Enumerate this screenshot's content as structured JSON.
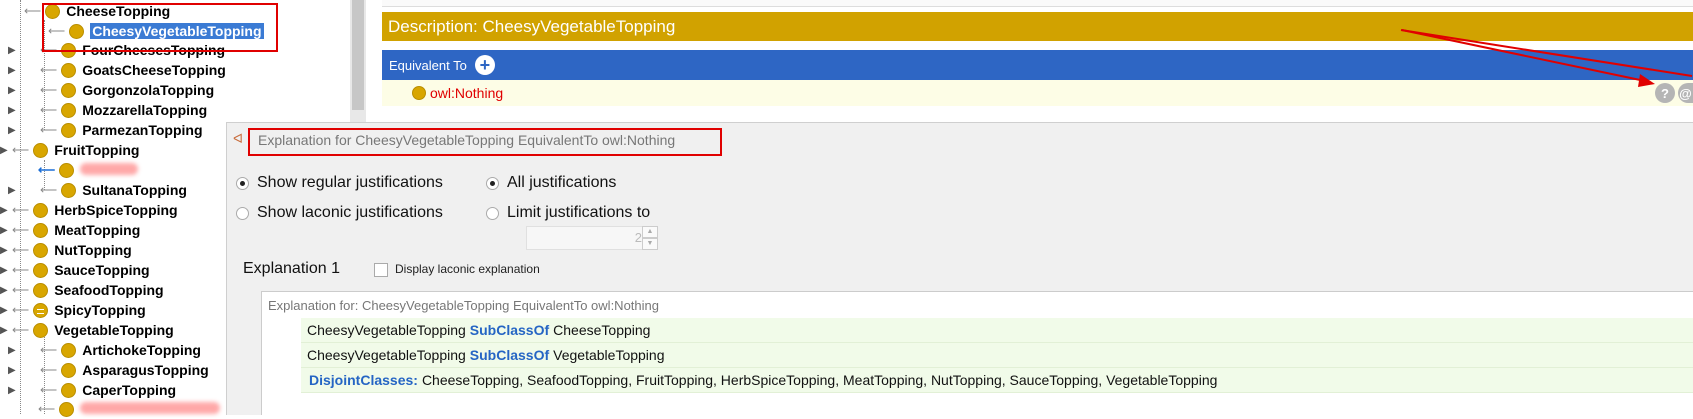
{
  "tree": {
    "nodes": [
      {
        "label": "CheeseTopping",
        "selected": false,
        "blurred": false
      },
      {
        "label": "CheesyVegetableTopping",
        "selected": true,
        "blurred": false
      },
      {
        "label": "FourCheesesTopping",
        "selected": false,
        "blurred": false
      },
      {
        "label": "GoatsCheeseTopping",
        "selected": false,
        "blurred": false
      },
      {
        "label": "GorgonzolaTopping",
        "selected": false,
        "blurred": false
      },
      {
        "label": "MozzarellaTopping",
        "selected": false,
        "blurred": false
      },
      {
        "label": "ParmezanTopping",
        "selected": false,
        "blurred": false
      },
      {
        "label": "FruitTopping",
        "selected": false,
        "blurred": false
      },
      {
        "label": "",
        "selected": false,
        "blurred": true
      },
      {
        "label": "SultanaTopping",
        "selected": false,
        "blurred": false
      },
      {
        "label": "HerbSpiceTopping",
        "selected": false,
        "blurred": false
      },
      {
        "label": "MeatTopping",
        "selected": false,
        "blurred": false
      },
      {
        "label": "NutTopping",
        "selected": false,
        "blurred": false
      },
      {
        "label": "SauceTopping",
        "selected": false,
        "blurred": false
      },
      {
        "label": "SeafoodTopping",
        "selected": false,
        "blurred": false
      },
      {
        "label": "SpicyTopping",
        "selected": false,
        "blurred": false
      },
      {
        "label": "VegetableTopping",
        "selected": false,
        "blurred": false
      },
      {
        "label": "ArtichokeTopping",
        "selected": false,
        "blurred": false
      },
      {
        "label": "AsparagusTopping",
        "selected": false,
        "blurred": false
      },
      {
        "label": "CaperTopping",
        "selected": false,
        "blurred": false
      },
      {
        "label": "",
        "selected": false,
        "blurred": true
      }
    ]
  },
  "description": {
    "header": "Description: CheesyVegetableTopping",
    "equivalent_to_label": "Equivalent To",
    "equivalent_value": "owl:Nothing"
  },
  "dialog": {
    "title": "Explanation for CheesyVegetableTopping EquivalentTo owl:Nothing",
    "options": {
      "regular": "Show regular justifications",
      "laconic": "Show laconic justifications",
      "all": "All justifications",
      "limit": "Limit justifications to",
      "limit_value": "2",
      "regular_selected": true,
      "all_selected": true
    },
    "explanation_title": "Explanation 1",
    "laconic_checkbox_label": "Display laconic explanation",
    "laconic_checked": false,
    "explanation_for": "Explanation for: CheesyVegetableTopping EquivalentTo owl:Nothing",
    "axioms": [
      {
        "subject": "CheesyVegetableTopping",
        "keyword": "SubClassOf",
        "object": "CheeseTopping"
      },
      {
        "subject": "CheesyVegetableTopping",
        "keyword": "SubClassOf",
        "object": "VegetableTopping"
      },
      {
        "subject": "",
        "keyword": "DisjointClasses:",
        "object": "CheeseTopping, SeafoodTopping, FruitTopping, HerbSpiceTopping, MeatTopping, NutTopping, SauceTopping, VegetableTopping"
      }
    ]
  },
  "colors": {
    "class_ball": "#d8a600",
    "description_bar": "#d1a200",
    "equivalent_bar": "#2e66c4",
    "keyword": "#2565c4",
    "annotation_red": "#e00000"
  }
}
